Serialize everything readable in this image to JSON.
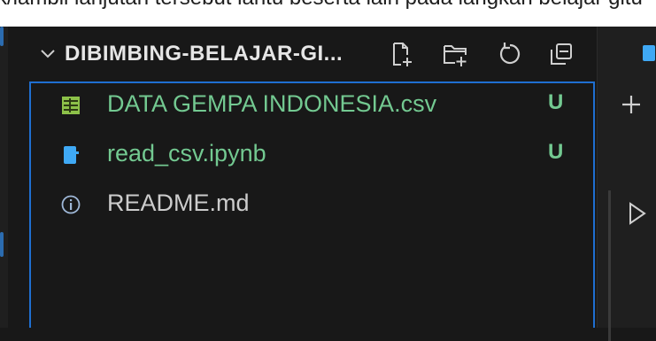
{
  "top_strip": {
    "text": "k/lambil lanjutan tersebut lantu beserta lain pada langkah belajar gitu"
  },
  "explorer": {
    "section_title": "DIBIMBING-BELAJAR-GI...",
    "actions": [
      "new-file-icon",
      "new-folder-icon",
      "refresh-icon",
      "collapse-all-icon"
    ],
    "files": [
      {
        "name": "DATA GEMPA INDONESIA.csv",
        "status": "U",
        "icon": "table-icon",
        "color": "#73c991"
      },
      {
        "name": "read_csv.ipynb",
        "status": "U",
        "icon": "notebook-icon",
        "color": "#73c991"
      },
      {
        "name": "README.md",
        "status": "",
        "icon": "info-icon",
        "color": "#cccccc"
      }
    ]
  },
  "right_panel": {
    "icons": [
      "tab-icon",
      "plus-icon",
      "play-icon"
    ]
  },
  "colors": {
    "accent": "#1f6fd1",
    "untracked": "#73c991",
    "background": "#181818"
  }
}
